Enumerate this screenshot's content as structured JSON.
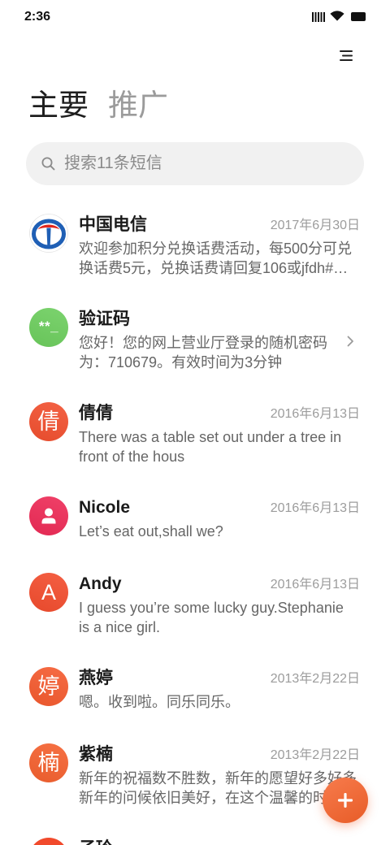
{
  "status_bar": {
    "time": "2:36",
    "icons": [
      "signal-icon",
      "wifi-icon",
      "battery-icon"
    ]
  },
  "header": {
    "menu_icon": "menu-icon",
    "tabs": [
      {
        "label": "主要",
        "active": true,
        "color": "#1e1e1e"
      },
      {
        "label": "推广",
        "active": false,
        "color": "#9b9b9b"
      }
    ]
  },
  "search": {
    "icon": "search-icon",
    "placeholder": "搜索11条短信"
  },
  "conversations": [
    {
      "name": "中国电信",
      "date": "2017年6月30日",
      "avatar": {
        "icon": "china-telecom-logo"
      },
      "message_lines": [
        "欢迎参加积分兑换话费活动，每500分可兑",
        "换话费5元，兑换话费请回复106或jfdh#…"
      ]
    },
    {
      "name": "验证码",
      "avatar": {
        "text": "**_",
        "color": "#6dce5e"
      },
      "message_lines": [
        "您好！您的网上营业厅登录的随机密码",
        "为：710679。有效时间为3分钟"
      ],
      "trailing_icon": "chevron-right-icon"
    },
    {
      "name": "倩倩",
      "date": "2016年6月13日",
      "avatar": {
        "text": "倩",
        "color": "#f2502f"
      },
      "message_lines": [
        "There was a table set out under a tree in",
        "front of the hous"
      ]
    },
    {
      "name": "Nicole",
      "date": "2016年6月13日",
      "avatar": {
        "icon": "person-icon",
        "color": "#ee2b57"
      },
      "message_lines": [
        "Let’s eat out,shall we?"
      ]
    },
    {
      "name": "Andy",
      "date": "2016年6月13日",
      "avatar": {
        "text": "A",
        "color": "#f34d2e"
      },
      "message_lines": [
        "I guess you’re some lucky guy.Stephanie",
        "is a nice girl."
      ]
    },
    {
      "name": "燕婷",
      "date": "2013年2月22日",
      "avatar": {
        "text": "婷",
        "color": "#f55b2f"
      },
      "message_lines": [
        "嗯。收到啦。同乐同乐。"
      ]
    },
    {
      "name": "紫楠",
      "date": "2013年2月22日",
      "avatar": {
        "text": "楠",
        "color": "#f5612f"
      },
      "message_lines": [
        "新年的祝福数不胜数，新年的愿望好多好多",
        "新年的问候依旧美好，在这个温馨的时"
      ]
    },
    {
      "name": "子玲",
      "avatar": {
        "color": "#f14a2c"
      }
    }
  ],
  "fab": {
    "icon": "plus-icon",
    "color": "#f6622a"
  }
}
